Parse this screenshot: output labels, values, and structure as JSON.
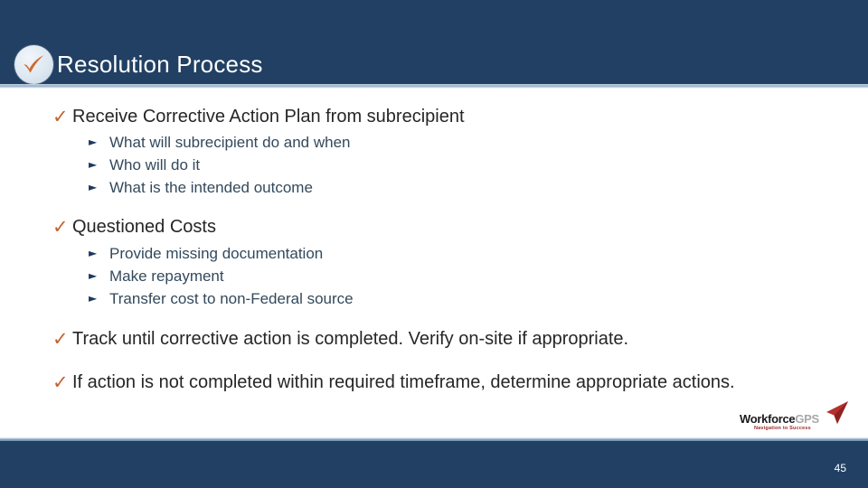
{
  "header": {
    "title": "Resolution Process",
    "icon": "check-circle-icon",
    "background_color": "#214063",
    "title_color": "#ffffff",
    "check_color": "#c8622e"
  },
  "bullets": [
    {
      "marker": "check-icon",
      "text": "Receive Corrective Action Plan from subrecipient",
      "sub": [
        {
          "marker": "triangle-icon",
          "text": "What will subrecipient do and when"
        },
        {
          "marker": "triangle-icon",
          "text": "Who will do it"
        },
        {
          "marker": "triangle-icon",
          "text": "What is the intended outcome"
        }
      ]
    },
    {
      "marker": "check-icon",
      "text": "Questioned Costs",
      "sub": [
        {
          "marker": "triangle-icon",
          "text": "Provide missing documentation"
        },
        {
          "marker": "triangle-icon",
          "text": "Make repayment"
        },
        {
          "marker": "triangle-icon",
          "text": "Transfer cost to non-Federal source"
        }
      ]
    },
    {
      "marker": "check-icon",
      "text": "Track until corrective action is completed. Verify on-site if appropriate.",
      "sub": []
    },
    {
      "marker": "check-icon",
      "text": "If action is not completed within required timeframe, determine appropriate actions.",
      "sub": []
    }
  ],
  "marker_glyphs": {
    "check": "✓",
    "triangle": "►"
  },
  "logo": {
    "word_primary": "Workforce",
    "word_secondary": "GPS",
    "tagline": "Navigation to Success",
    "arrow": "red-arrow-icon",
    "accent_color": "#9e2a2b"
  },
  "footer": {
    "page_number": "45",
    "background_color": "#214063"
  }
}
